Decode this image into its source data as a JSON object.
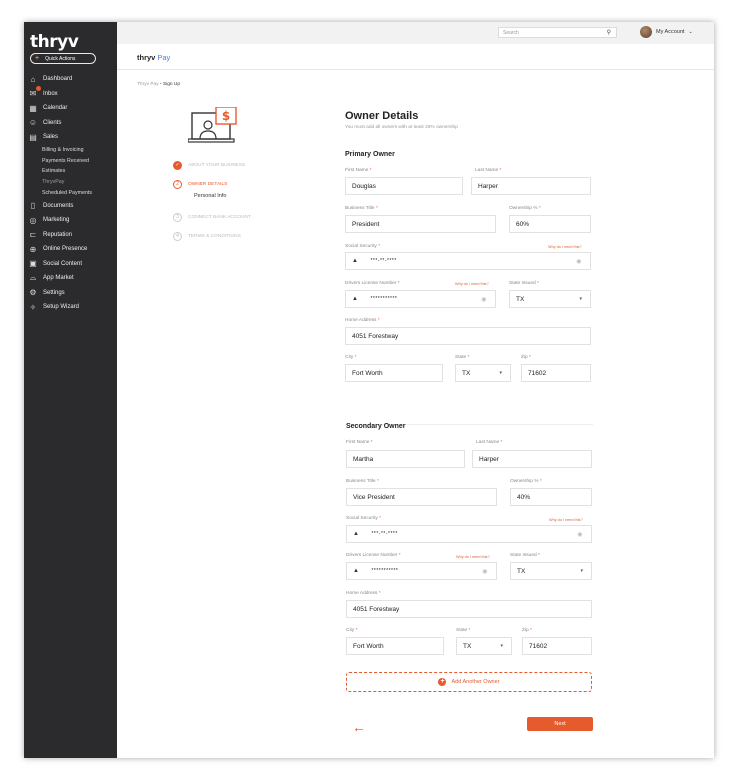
{
  "app": {
    "logo": "thryv",
    "quick_actions": "Quick Actions"
  },
  "sidebar": {
    "items": [
      {
        "label": "Dashboard",
        "icon": "home-icon"
      },
      {
        "label": "Inbox",
        "icon": "inbox-icon"
      },
      {
        "label": "Calendar",
        "icon": "calendar-icon"
      },
      {
        "label": "Clients",
        "icon": "clients-icon"
      },
      {
        "label": "Sales",
        "icon": "sales-icon"
      }
    ],
    "sales_sub": [
      "Billing & Invoicing",
      "Payments Received",
      "Estimates",
      "ThryvPay",
      "Scheduled Payments"
    ],
    "items2": [
      {
        "label": "Documents",
        "icon": "documents-icon"
      },
      {
        "label": "Marketing",
        "icon": "marketing-icon"
      },
      {
        "label": "Reputation",
        "icon": "reputation-icon"
      },
      {
        "label": "Online Presence",
        "icon": "globe-icon"
      },
      {
        "label": "Social Content",
        "icon": "social-icon"
      },
      {
        "label": "App Market",
        "icon": "store-icon"
      },
      {
        "label": "Settings",
        "icon": "gear-icon"
      },
      {
        "label": "Setup Wizard",
        "icon": "wand-icon"
      }
    ]
  },
  "topbar": {
    "search_placeholder": "Search",
    "account": "My Account"
  },
  "appbar": {
    "logo_main": "thryv",
    "logo_pay": "Pay"
  },
  "breadcrumb": {
    "parent": "Thryv Pay",
    "sep": " • ",
    "current": "Sign Up"
  },
  "steps": [
    {
      "label": "ABOUT YOUR BUSINESS",
      "state": "done"
    },
    {
      "label": "OWNER DETAILS",
      "state": "active",
      "sub": "Personal Info"
    },
    {
      "label": "CONNECT BANK ACCOUNT",
      "state": "todo"
    },
    {
      "label": "TERMS & CONDITIONS",
      "state": "todo"
    }
  ],
  "form": {
    "title": "Owner Details",
    "subtitle": "You must add all owners with at least 25% ownership",
    "labels": {
      "first_name": "First Name",
      "last_name": "Last Name",
      "business_title": "Business Title",
      "ownership": "Ownership %",
      "social_security": "Social Security",
      "why": "Why do I need this?",
      "drivers_license": "Drivers License Number",
      "state_issued": "State Issued",
      "home_address": "Home Address",
      "city": "City",
      "state": "State",
      "zip": "Zip",
      "req": "*"
    },
    "primary": {
      "heading": "Primary Owner",
      "first_name": "Douglas",
      "last_name": "Harper",
      "business_title": "President",
      "ownership": "60%",
      "ssn": "***-**-****",
      "license": "***********",
      "state_issued": "TX",
      "address": "4051 Forestway",
      "city": "Fort Worth",
      "state": "TX",
      "zip": "71602"
    },
    "secondary": {
      "heading": "Secondary Owner",
      "first_name": "Martha",
      "last_name": "Harper",
      "business_title": "Vice President",
      "ownership": "40%",
      "ssn": "***-**-****",
      "license": "***********",
      "state_issued": "TX",
      "address": "4051 Forestway",
      "city": "Fort Worth",
      "state": "TX",
      "zip": "71602"
    },
    "add_owner": "Add Another Owner",
    "back": "←",
    "next": "Next"
  },
  "colors": {
    "accent": "#e65b2e",
    "sidebar": "#2b2b2d",
    "pay_blue": "#4a7de0"
  }
}
